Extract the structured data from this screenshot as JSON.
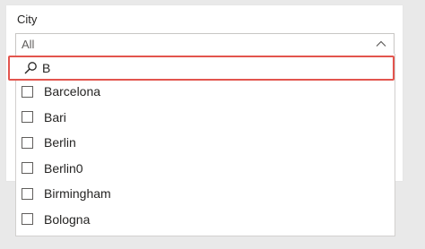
{
  "slicer": {
    "title": "City",
    "selected_value": "All"
  },
  "search": {
    "value": "B",
    "icon": "search-icon"
  },
  "options": [
    {
      "label": "Barcelona",
      "checked": false
    },
    {
      "label": "Bari",
      "checked": false
    },
    {
      "label": "Berlin",
      "checked": false
    },
    {
      "label": "Berlin0",
      "checked": false
    },
    {
      "label": "Birmingham",
      "checked": false
    },
    {
      "label": "Bologna",
      "checked": false
    }
  ],
  "colors": {
    "search_highlight": "#e3554e",
    "text": "#252423",
    "border": "#c8c6c4"
  }
}
